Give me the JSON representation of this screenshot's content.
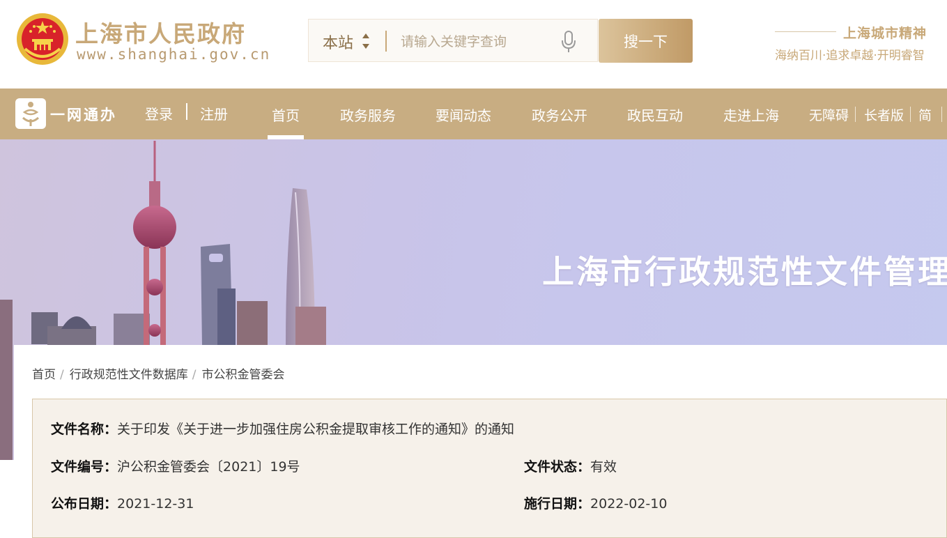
{
  "header": {
    "site_title": "上海市人民政府",
    "site_url": "www.shanghai.gov.cn",
    "search": {
      "scope": "本站",
      "placeholder": "请输入关键字查询",
      "button": "搜一下"
    },
    "spirit": {
      "title": "上海城市精神",
      "words": "海纳百川·追求卓越·开明睿智"
    }
  },
  "navbar": {
    "ywtb": "一网通办",
    "login": "登录",
    "register": "注册",
    "items": [
      "首页",
      "政务服务",
      "要闻动态",
      "政务公开",
      "政民互动",
      "走进上海"
    ],
    "active_index": 0,
    "tools": [
      "无障碍",
      "长者版",
      "简"
    ]
  },
  "banner": {
    "title": "上海市行政规范性文件管理"
  },
  "breadcrumb": [
    "首页",
    "行政规范性文件数据库",
    "市公积金管委会"
  ],
  "document": {
    "name_label": "文件名称：",
    "name": "关于印发《关于进一步加强住房公积金提取审核工作的通知》的通知",
    "number_label": "文件编号：",
    "number": "沪公积金管委会〔2021〕19号",
    "status_label": "文件状态：",
    "status": "有效",
    "publish_label": "公布日期：",
    "publish_date": "2021-12-31",
    "effective_label": "施行日期：",
    "effective_date": "2022-02-10"
  },
  "colors": {
    "gold": "#c8ad82",
    "accent_text": "#c8a878",
    "emblem_red": "#d8222a"
  }
}
